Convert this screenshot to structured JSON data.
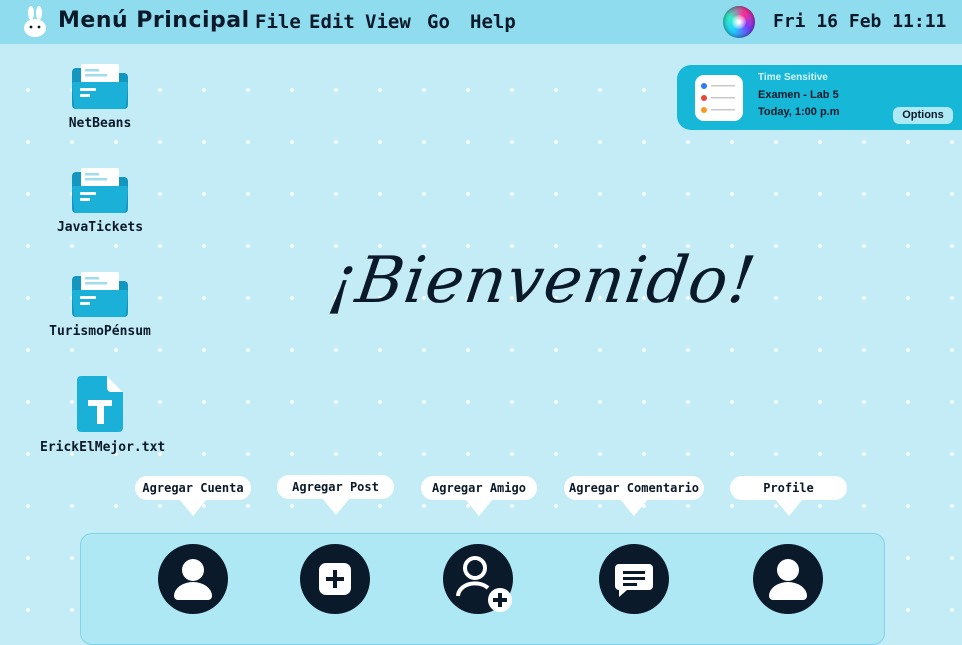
{
  "menubar": {
    "logo_icon": "rabbit-icon",
    "app_title": "Menú Principal",
    "menus": [
      "File",
      "Edit",
      "View",
      "Go",
      "Help"
    ],
    "siri_icon": "siri-icon",
    "clock": "Fri 16 Feb 11:11"
  },
  "desktop_icons": [
    {
      "label": "NetBeans",
      "icon": "folder-icon"
    },
    {
      "label": "JavaTickets",
      "icon": "folder-icon"
    },
    {
      "label": "TurismoPénsum",
      "icon": "folder-icon"
    },
    {
      "label": "ErickElMejor.txt",
      "icon": "text-file-icon"
    }
  ],
  "notification": {
    "kind": "Time Sensitive",
    "title": "Examen - Lab 5",
    "time": "Today, 1:00 p.m",
    "button": "Options",
    "icon": "reminders-icon"
  },
  "welcome_text": "¡Bienvenido!",
  "dock": {
    "tooltips": [
      "Agregar Cuenta",
      "Agregar Post",
      "Agregar Amigo",
      "Agregar Comentario",
      "Profile"
    ],
    "icons": [
      "add-account-icon",
      "add-post-icon",
      "add-friend-icon",
      "add-comment-icon",
      "profile-icon"
    ]
  },
  "colors": {
    "background": "#c4ecf6",
    "menubar": "#8fdcef",
    "accent": "#17b7d8",
    "icon_blue": "#1ab0d8",
    "dark": "#0b1a2a"
  }
}
